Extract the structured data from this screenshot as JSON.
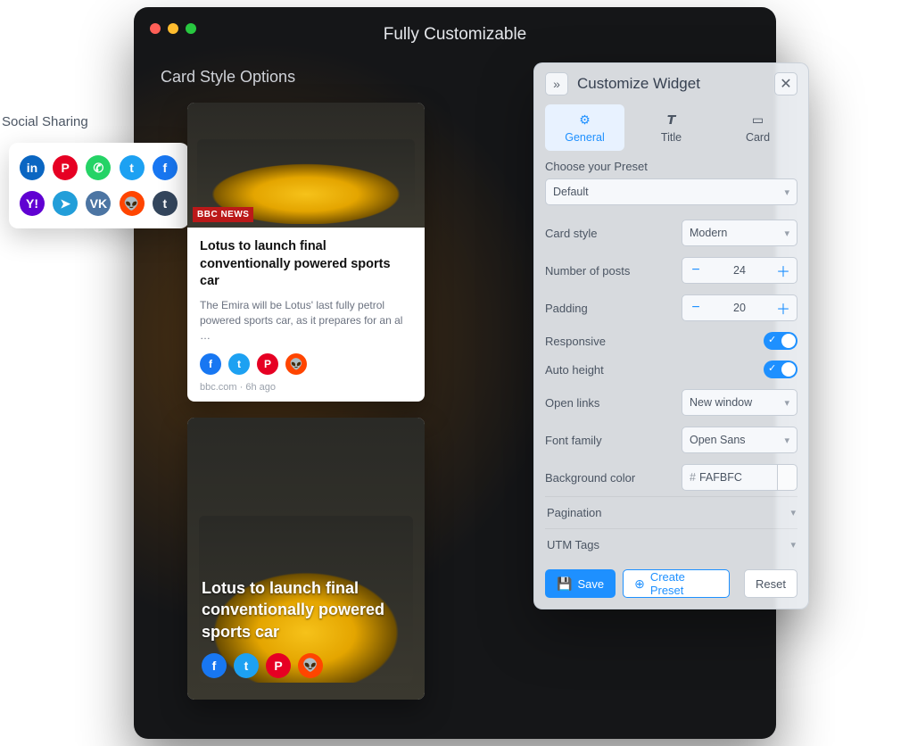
{
  "window": {
    "title": "Fully Customizable",
    "card_section_title": "Card Style Options"
  },
  "social": {
    "label": "Social Sharing",
    "icons": [
      {
        "name": "linkedin",
        "glyph": "in"
      },
      {
        "name": "pinterest",
        "glyph": "P"
      },
      {
        "name": "whatsapp",
        "glyph": "✆"
      },
      {
        "name": "twitter",
        "glyph": "t"
      },
      {
        "name": "facebook",
        "glyph": "f"
      },
      {
        "name": "yahoo",
        "glyph": "Y!"
      },
      {
        "name": "telegram",
        "glyph": "➤"
      },
      {
        "name": "vk",
        "glyph": "VK"
      },
      {
        "name": "reddit",
        "glyph": "👽"
      },
      {
        "name": "tumblr",
        "glyph": "t"
      }
    ]
  },
  "card1": {
    "source_tag": "BBC NEWS",
    "title": "Lotus to launch final conventionally powered sports car",
    "desc": "The Emira will be Lotus' last fully petrol powered sports car, as it prepares for an al  …",
    "source": "bbc.com",
    "sep": " · ",
    "age": "6h ago"
  },
  "card2": {
    "title": "Lotus to launch final conventionally powered sports car"
  },
  "panel": {
    "title": "Customize Widget",
    "tabs": {
      "general": "General",
      "title_tab": "Title",
      "card": "Card"
    },
    "preset_head": "Choose your Preset",
    "preset_value": "Default",
    "card_style_label": "Card style",
    "card_style_value": "Modern",
    "num_posts_label": "Number of posts",
    "num_posts_value": "24",
    "padding_label": "Padding",
    "padding_value": "20",
    "responsive_label": "Responsive",
    "auto_height_label": "Auto height",
    "open_links_label": "Open links",
    "open_links_value": "New window",
    "font_family_label": "Font family",
    "font_family_value": "Open Sans",
    "bg_label": "Background color",
    "bg_prefix": "#",
    "bg_value": "FAFBFC",
    "pagination_label": "Pagination",
    "utm_label": "UTM Tags",
    "save": "Save",
    "create_preset": "Create Preset",
    "reset": "Reset"
  }
}
